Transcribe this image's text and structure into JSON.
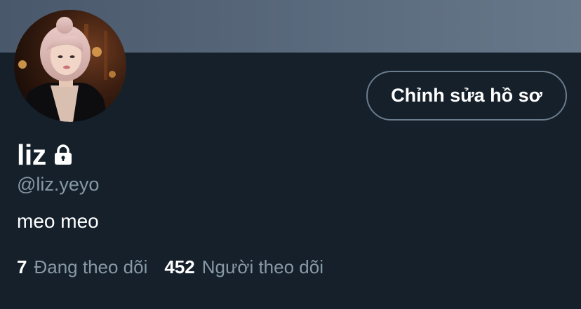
{
  "profile": {
    "display_name": "liz",
    "handle": "@liz.yeyo",
    "bio": "meo meo",
    "locked": true
  },
  "actions": {
    "edit_profile_label": "Chỉnh sửa hồ sơ"
  },
  "stats": {
    "following_count": "7",
    "following_label": "Đang theo dõi",
    "followers_count": "452",
    "followers_label": "Người theo dõi"
  },
  "icons": {
    "lock": "lock-icon"
  },
  "colors": {
    "background": "#15202b",
    "banner": "#5a6a7d",
    "secondary_text": "#8899a6",
    "button_border": "#6b7c8c"
  }
}
